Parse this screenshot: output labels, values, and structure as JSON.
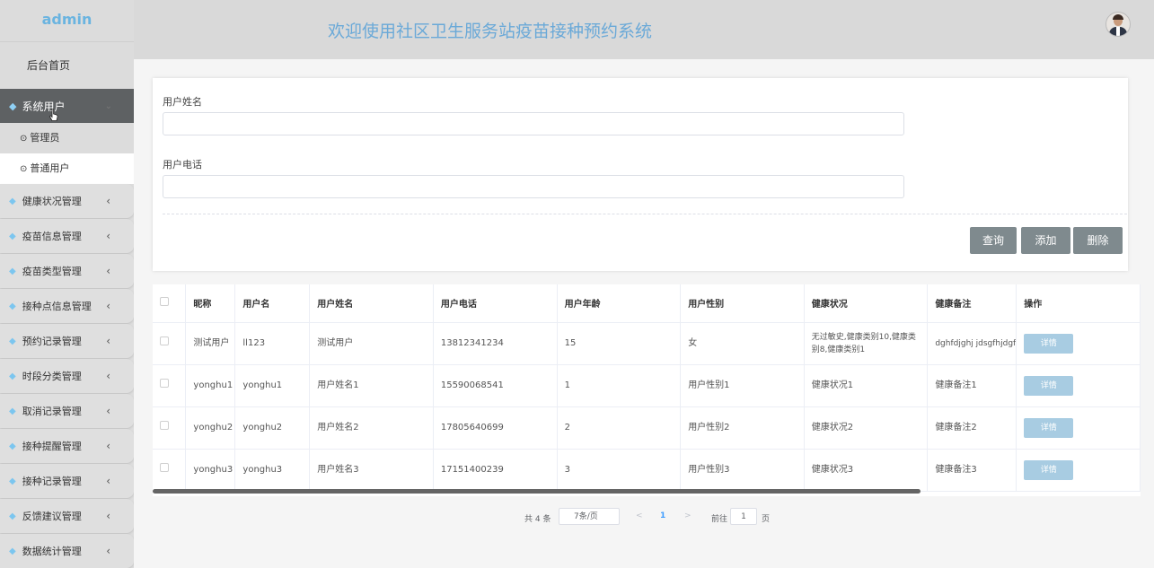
{
  "brand": "admin",
  "header": {
    "title": "欢迎使用社区卫生服务站疫苗接种预约系统"
  },
  "sidebar": {
    "home": "后台首页",
    "active_menu": "系统用户",
    "submenu": [
      "管理员",
      "普通用户"
    ],
    "groups": [
      "健康状况管理",
      "疫苗信息管理",
      "疫苗类型管理",
      "接种点信息管理",
      "预约记录管理",
      "时段分类管理",
      "取消记录管理",
      "接种提醒管理",
      "接种记录管理",
      "反馈建议管理",
      "数据统计管理"
    ]
  },
  "search": {
    "name_label": "用户姓名",
    "name_value": "",
    "phone_label": "用户电话",
    "phone_value": "",
    "query_btn": "查询",
    "add_btn": "添加",
    "delete_btn": "删除"
  },
  "table": {
    "headers": [
      "昵称",
      "用户名",
      "用户姓名",
      "用户电话",
      "用户年龄",
      "用户性别",
      "健康状况",
      "健康备注",
      "操作"
    ],
    "rows": [
      [
        "测试用户",
        "ll123",
        "测试用户",
        "13812341234",
        "15",
        "女",
        "无过敏史,健康类别10,健康类别8,健康类别1",
        "dghfdjghj jdsgfhjdgf",
        "详情"
      ],
      [
        "yonghu1",
        "yonghu1",
        "用户姓名1",
        "15590068541",
        "1",
        "用户性别1",
        "健康状况1",
        "健康备注1",
        "详情"
      ],
      [
        "yonghu2",
        "yonghu2",
        "用户姓名2",
        "17805640699",
        "2",
        "用户性别2",
        "健康状况2",
        "健康备注2",
        "详情"
      ],
      [
        "yonghu3",
        "yonghu3",
        "用户姓名3",
        "17151400239",
        "3",
        "用户性别3",
        "健康状况3",
        "健康备注3",
        "详情"
      ]
    ]
  },
  "pager": {
    "total": "共 4 条",
    "page_size": "7条/页",
    "prev": "<",
    "current": "1",
    "next": ">",
    "goto": "前往",
    "goto_value": "1",
    "page_word": "页"
  },
  "colors": {
    "title": "#6aa9d8",
    "active_menu_bg": "#5e6163",
    "button": "#7f8a8e",
    "detail_button": "#a8cce2"
  }
}
